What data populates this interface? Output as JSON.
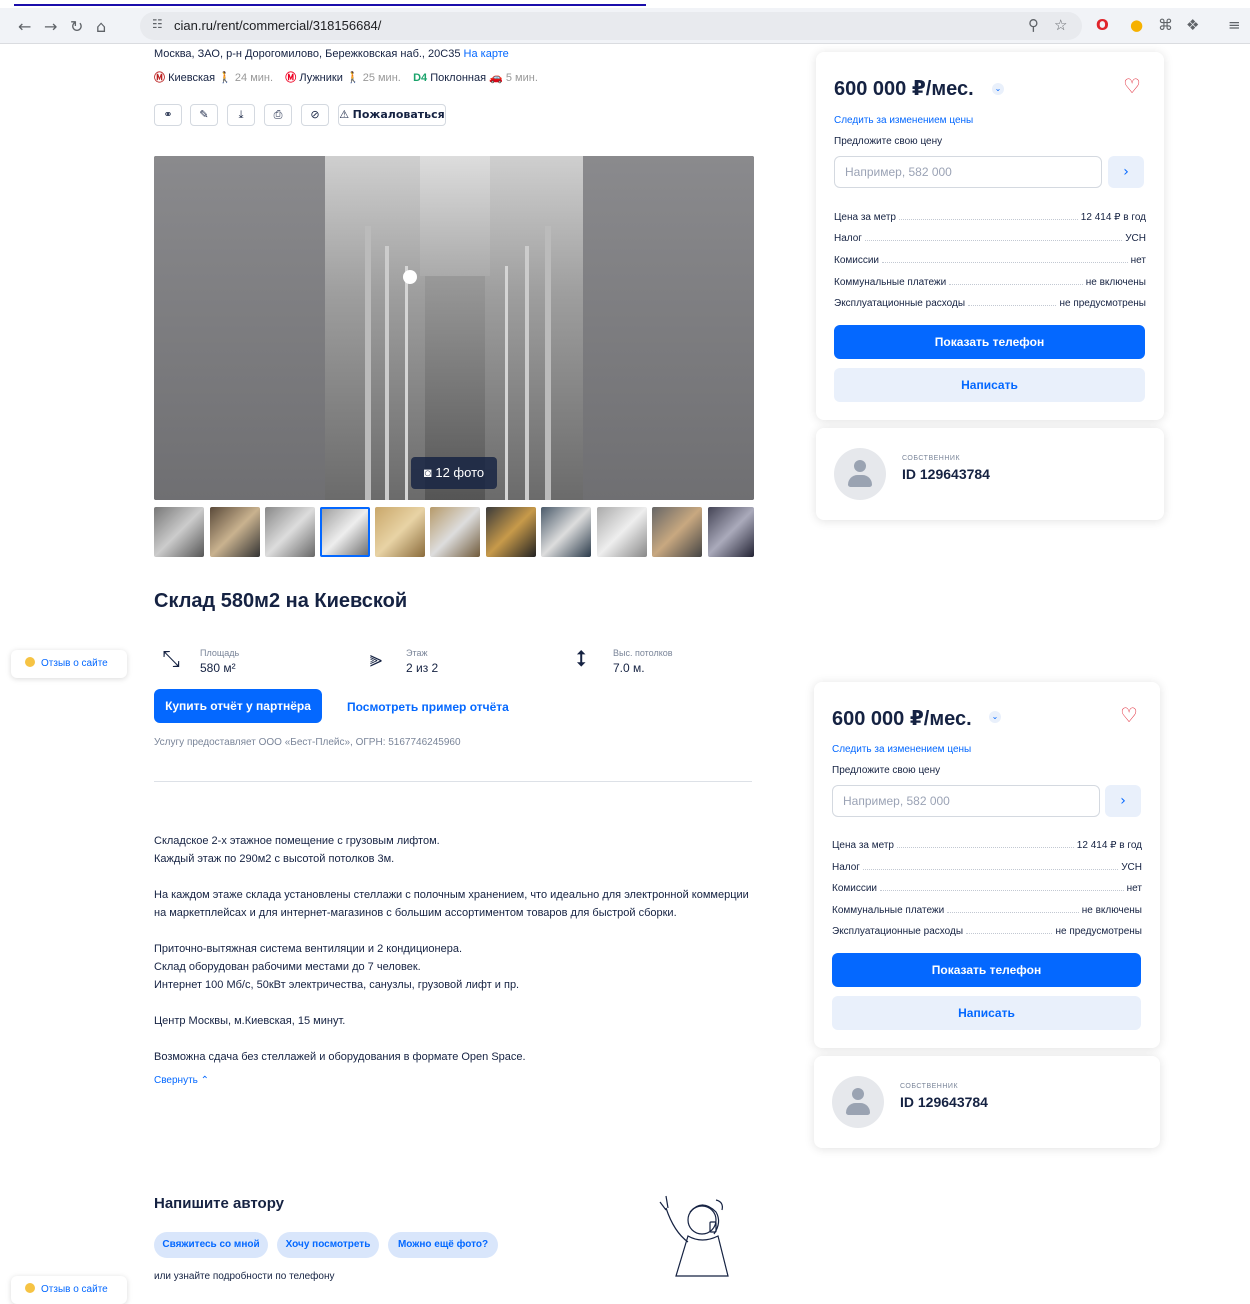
{
  "browser": {
    "url": "cian.ru/rent/commercial/318156684/"
  },
  "listing": {
    "address": "Москва, ЗАО, р-н Дорогомилово, Бережковская наб., 20С35",
    "map_link": "На карте",
    "metro": [
      {
        "name": "Киевская",
        "time": "24 мин."
      },
      {
        "name": "Лужники",
        "time": "25 мин."
      },
      {
        "name": "Поклонная",
        "time": "5 мин.",
        "line": "D4"
      }
    ],
    "complain": "Пожаловаться",
    "photo_count": "12 фото",
    "title": "Склад 580м2 на Киевской",
    "features": [
      {
        "label": "Площадь",
        "value": "580 м²"
      },
      {
        "label": "Этаж",
        "value": "2 из 2"
      },
      {
        "label": "Выс. потолков",
        "value": "7.0 м."
      }
    ],
    "buy_report": "Купить отчёт у партнёра",
    "sample_report": "Посмотреть пример отчёта",
    "service_note": "Услугу предоставляет ООО «Бест-Плейс», ОГРН: 5167746245960",
    "description": [
      "Складское 2-х этажное помещение с грузовым лифтом.\nКаждый этаж по 290м2 с высотой потолков 3м.",
      "На каждом этаже склада установлены стеллажи с полочным хранением, что идеально для электронной коммерции на маркетплейсах и для интернет-магазинов с большим ассортиментом товаров для быстрой сборки.",
      "Приточно-вытяжная система вентиляции и 2 кондиционера.\nСклад оборудован рабочими местами до 7 человек.\nИнтернет 100 Мб/с, 50кВт электричества, санузлы, грузовой лифт и пр.",
      "Центр Москвы, м.Киевская, 15 минут.",
      "Возможна сдача без стеллажей и оборудования в формате Open Space."
    ],
    "collapse": "Свернуть"
  },
  "write_author": {
    "title": "Напишите автору",
    "pills": [
      "Свяжитесь со мной",
      "Хочу посмотреть",
      "Можно ещё фото?"
    ],
    "phone_note": "или узнайте подробности по телефону"
  },
  "price_card": {
    "price": "600 000 ₽/мес.",
    "track": "Следить за изменением цены",
    "offer_label": "Предложите свою цену",
    "offer_placeholder": "Например, 582 000",
    "rows": [
      {
        "k": "Цена за метр",
        "v": "12 414 ₽ в год"
      },
      {
        "k": "Налог",
        "v": "УСН"
      },
      {
        "k": "Комиссии",
        "v": "нет"
      },
      {
        "k": "Коммунальные платежи",
        "v": "не включены"
      },
      {
        "k": "Эксплуатационные расходы",
        "v": "не предусмотрены"
      }
    ],
    "show_phone": "Показать телефон",
    "write": "Написать"
  },
  "owner": {
    "label": "собственник",
    "id": "ID 129643784"
  },
  "feedback": "Отзыв о сайте",
  "colors": {
    "accent": "#0468ff",
    "heart": "#e12d3c",
    "text": "#152242"
  }
}
